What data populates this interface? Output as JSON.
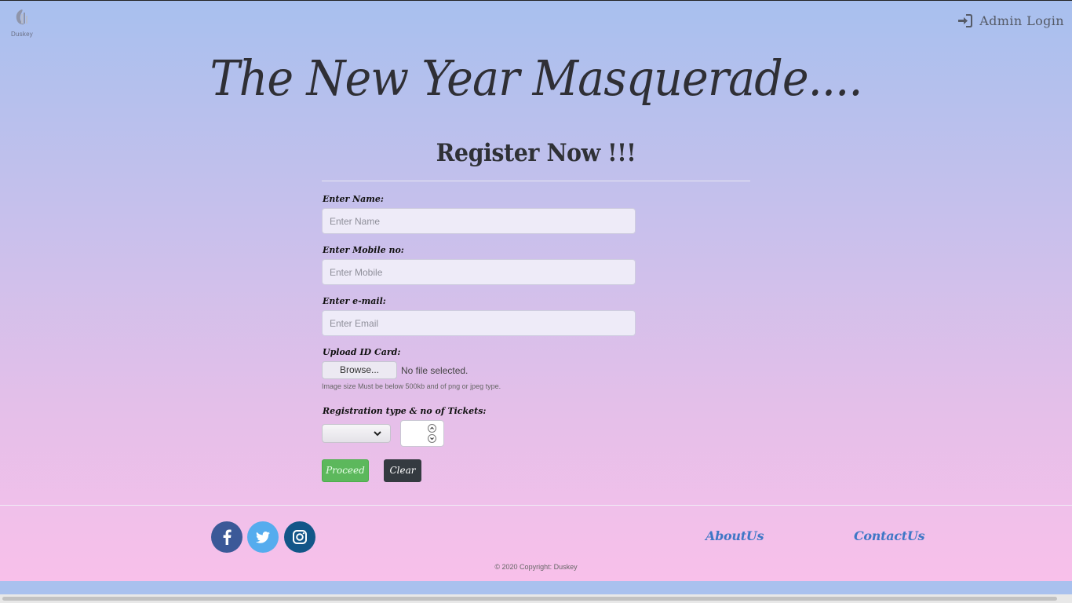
{
  "header": {
    "logo_text": "Duskey",
    "admin_login_label": "Admin Login"
  },
  "title": "The New Year Masquerade....",
  "form": {
    "heading": "Register Now !!!",
    "name_label": "Enter Name:",
    "name_placeholder": "Enter Name",
    "mobile_label": "Enter Mobile no:",
    "mobile_placeholder": "Enter Mobile",
    "email_label": "Enter e-mail:",
    "email_placeholder": "Enter Email",
    "upload_label": "Upload ID Card:",
    "browse_label": "Browse...",
    "no_file_text": "No file selected.",
    "upload_hint": "Image size Must be below 500kb and of png or jpeg type.",
    "registration_label": "Registration type & no of Tickets:",
    "registration_type_value": "",
    "tickets_value": "",
    "proceed_label": "Proceed",
    "clear_label": "Clear"
  },
  "footer": {
    "social_icons": [
      "facebook-icon",
      "twitter-icon",
      "instagram-icon"
    ],
    "social_colors": {
      "facebook": "#3b5998",
      "twitter": "#55acee",
      "instagram": "#125688"
    },
    "about_label": "AboutUs",
    "contact_label": "ContactUs",
    "copyright": "© 2020 Copyright: Duskey"
  },
  "colors": {
    "proceed": "#5cb85c",
    "clear": "#343a40",
    "link": "#3f77c6"
  }
}
